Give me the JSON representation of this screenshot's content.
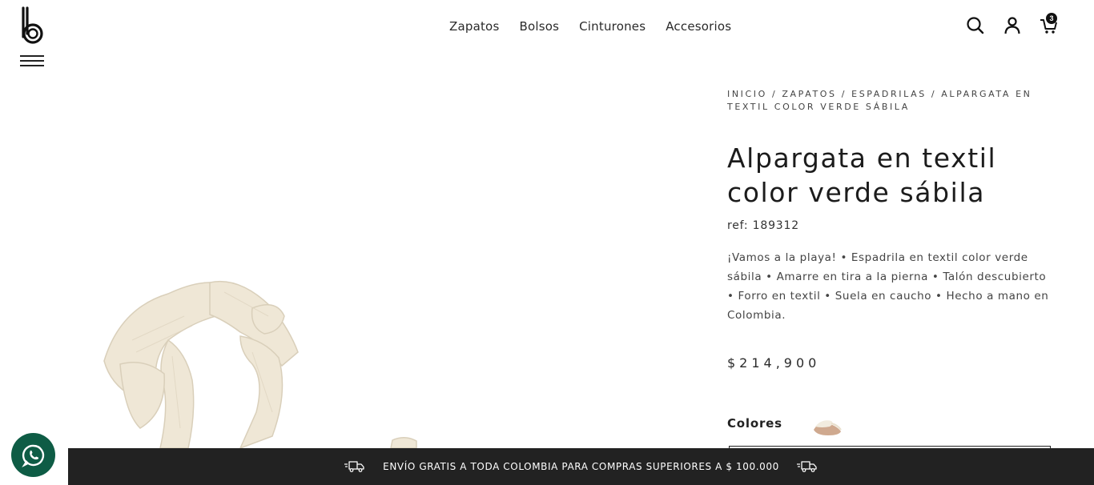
{
  "header": {
    "nav": [
      "Zapatos",
      "Bolsos",
      "Cinturones",
      "Accesorios"
    ],
    "icons": [
      "search-icon",
      "user-icon",
      "cart-icon"
    ],
    "cart_count": "3"
  },
  "breadcrumb": {
    "items": [
      "INICIO",
      "ZAPATOS",
      "ESPADRILAS",
      "ALPARGATA EN TEXTIL COLOR VERDE SÁBILA"
    ],
    "separator": " / "
  },
  "product": {
    "title": "Alpargata en textil color verde sábila",
    "ref": "ref: 189312",
    "description": "¡Vamos a la playa! • Espadrila en textil color verde sábila • Amarre en tira a la pierna • Talón descubierto • Forro en textil • Suela en caucho • Hecho a mano en Colombia.",
    "price": "$214,900",
    "colors_label": "Colores"
  },
  "banner": {
    "text": "ENVÍO GRATIS A TODA COLOMBIA PARA COMPRAS SUPERIORES A $ 100.000"
  },
  "colors": {
    "banner_bg": "#222222",
    "whatsapp_bg": "#0e5c45",
    "strap": "#efe7d6"
  }
}
